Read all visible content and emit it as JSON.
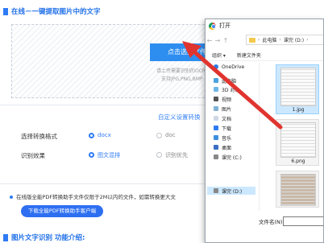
{
  "header": {
    "title": "在线－一键提取图片中的文字"
  },
  "upload": {
    "button_label": "点击选择文件",
    "hint_line1": "请上传需要识别的OCR",
    "hint_line2": "支持JPG,PNG,BMP"
  },
  "settings": {
    "custom_link": "自定义设置转换",
    "format_label": "选择转换格式",
    "format_options": [
      "docx",
      "doc"
    ],
    "effect_label": "识别效果",
    "effect_options": [
      "图文混排",
      "识别优先"
    ]
  },
  "notice": {
    "text": "在线版全能PDF转换助手文件仅限于2M以内的文件，如需转换更大文"
  },
  "download_button": "下载全能PDF转换助手客户端",
  "section2": {
    "title": "图片文字识别 功能介绍:"
  },
  "dialog": {
    "title": "打开",
    "breadcrumb": [
      "此电脑",
      "课完 (D:)"
    ],
    "toolbar": {
      "organize": "组织 ▾",
      "new_folder": "新建文件夹"
    },
    "tree": [
      "OneDrive",
      "此电脑",
      "3D 对象",
      "视频",
      "图片",
      "文档",
      "下载",
      "音乐",
      "桌面",
      "课完 (C:)",
      "课完 (D:)"
    ],
    "files": [
      "1.jpg",
      "6.png",
      ""
    ],
    "filename_label": "文件名(N):"
  },
  "colors": {
    "accent": "#2f7bf5",
    "arrow": "#e0342f"
  }
}
